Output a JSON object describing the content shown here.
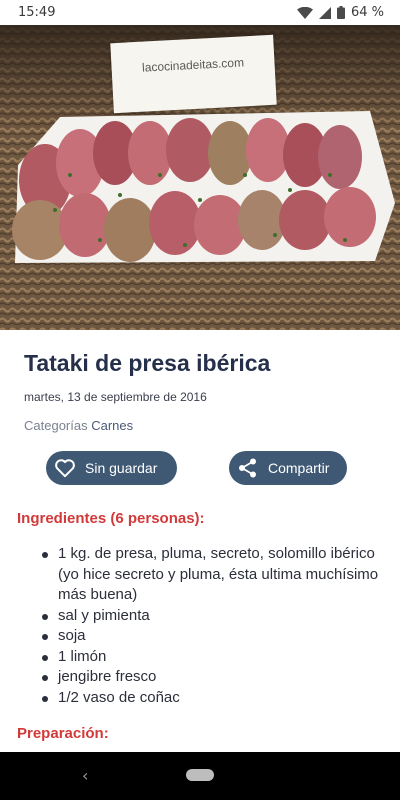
{
  "status_bar": {
    "time": "15:49",
    "battery": "64 %",
    "icons": [
      "wifi-icon",
      "signal-icon",
      "battery-icon"
    ]
  },
  "hero": {
    "watermark": "lacocinadeitas.com"
  },
  "recipe": {
    "title": "Tataki de presa ibérica",
    "date": "martes, 13 de septiembre de 2016",
    "categories_label": "Categorías",
    "category": "Carnes"
  },
  "actions": {
    "save_label": "Sin guardar",
    "share_label": "Compartir"
  },
  "ingredients": {
    "heading": "Ingredientes (6 personas):",
    "items": [
      "1 kg. de presa, pluma, secreto, solomillo ibérico (yo hice secreto y pluma, ésta ultima muchísimo más buena)",
      "sal y pimienta",
      "soja",
      "1 limón",
      "jengibre fresco",
      "1/2 vaso de coñac"
    ]
  },
  "preparation": {
    "heading": "Preparación:"
  },
  "nav_bar": {
    "back": "‹"
  },
  "colors": {
    "accent_red": "#d23a3a",
    "button_bg": "#3f5873",
    "title": "#26304a"
  }
}
